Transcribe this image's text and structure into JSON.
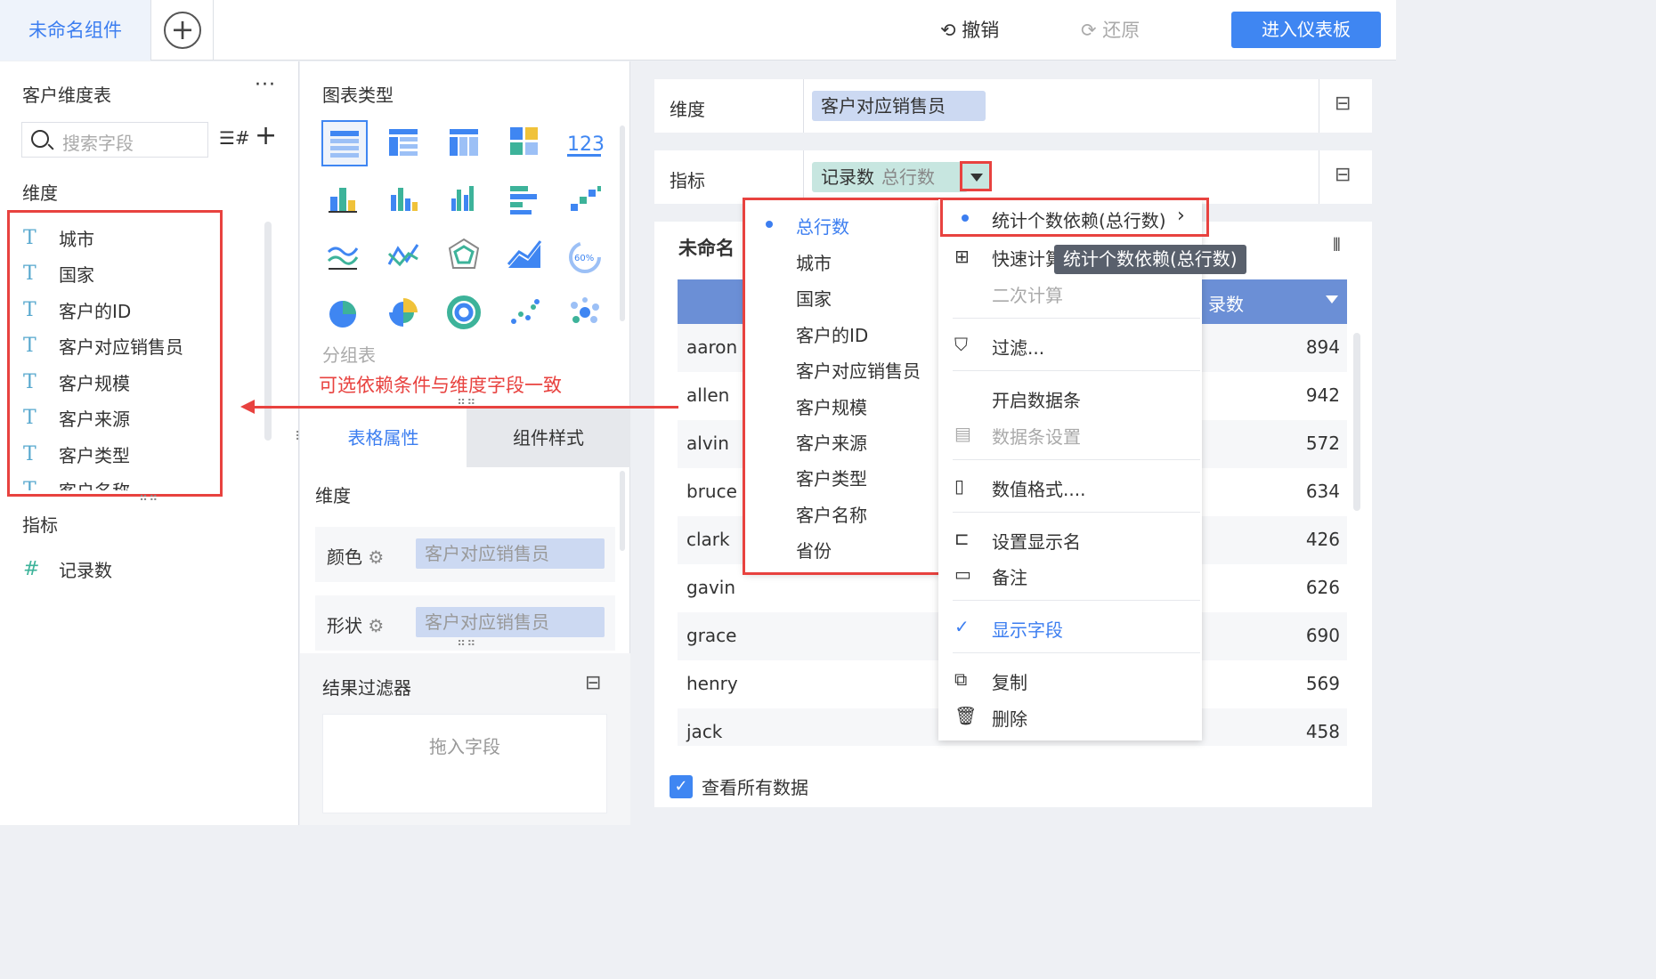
{
  "topbar": {
    "tab_name": "未命名组件",
    "undo": "撤销",
    "redo": "还原",
    "enter_dashboard": "进入仪表板"
  },
  "left": {
    "table_title": "客户维度表",
    "more": "···",
    "search_placeholder": "搜索字段",
    "dimension_label": "维度",
    "dimensions": [
      "城市",
      "国家",
      "客户的ID",
      "客户对应销售员",
      "客户规模",
      "客户来源",
      "客户类型",
      "客户名称"
    ],
    "measure_label": "指标",
    "measures": [
      "记录数"
    ]
  },
  "middle": {
    "chart_type_label": "图表类型",
    "group_table_label": "分组表",
    "tabs": [
      "表格属性",
      "组件样式"
    ],
    "dimension_label": "维度",
    "color_label": "颜色",
    "color_value": "客户对应销售员",
    "shape_label": "形状",
    "shape_value": "客户对应销售员",
    "result_filter_label": "结果过滤器",
    "drop_hint": "拖入字段"
  },
  "right": {
    "dim_shelf_label": "维度",
    "dim_chip": "客户对应销售员",
    "measure_shelf_label": "指标",
    "measure_chip": "记录数",
    "measure_chip_sub": "总行数",
    "canvas_title": "未命名",
    "col_header_right": "录数",
    "rows": [
      {
        "name": "aaron",
        "value": "894"
      },
      {
        "name": "allen",
        "value": "942"
      },
      {
        "name": "alvin",
        "value": "572"
      },
      {
        "name": "bruce",
        "value": "634"
      },
      {
        "name": "clark",
        "value": "426"
      },
      {
        "name": "gavin",
        "value": "626"
      },
      {
        "name": "grace",
        "value": "690"
      },
      {
        "name": "henry",
        "value": "569"
      },
      {
        "name": "jack",
        "value": "458"
      }
    ],
    "view_all_data": "查看所有数据"
  },
  "dependency_menu": {
    "items": [
      "总行数",
      "城市",
      "国家",
      "客户的ID",
      "客户对应销售员",
      "客户规模",
      "客户来源",
      "客户类型",
      "客户名称",
      "省份"
    ],
    "selected": "总行数"
  },
  "context_menu": {
    "count_dependency": "统计个数依赖(总行数)",
    "quick_calc": "快速计算",
    "secondary_calc": "二次计算",
    "filter": "过滤...",
    "enable_databar": "开启数据条",
    "databar_settings": "数据条设置",
    "number_format": "数值格式....",
    "set_display_name": "设置显示名",
    "remark": "备注",
    "show_field": "显示字段",
    "copy": "复制",
    "delete": "删除"
  },
  "tooltip": "统计个数依赖(总行数)",
  "annotation": "可选依赖条件与维度字段一致",
  "colors": {
    "accent": "#3f86f2",
    "highlight_red": "#e8423f",
    "table_header": "#6b8fd6",
    "dim_chip": "#ccd9f2",
    "measure_chip": "#c7e6e0"
  }
}
